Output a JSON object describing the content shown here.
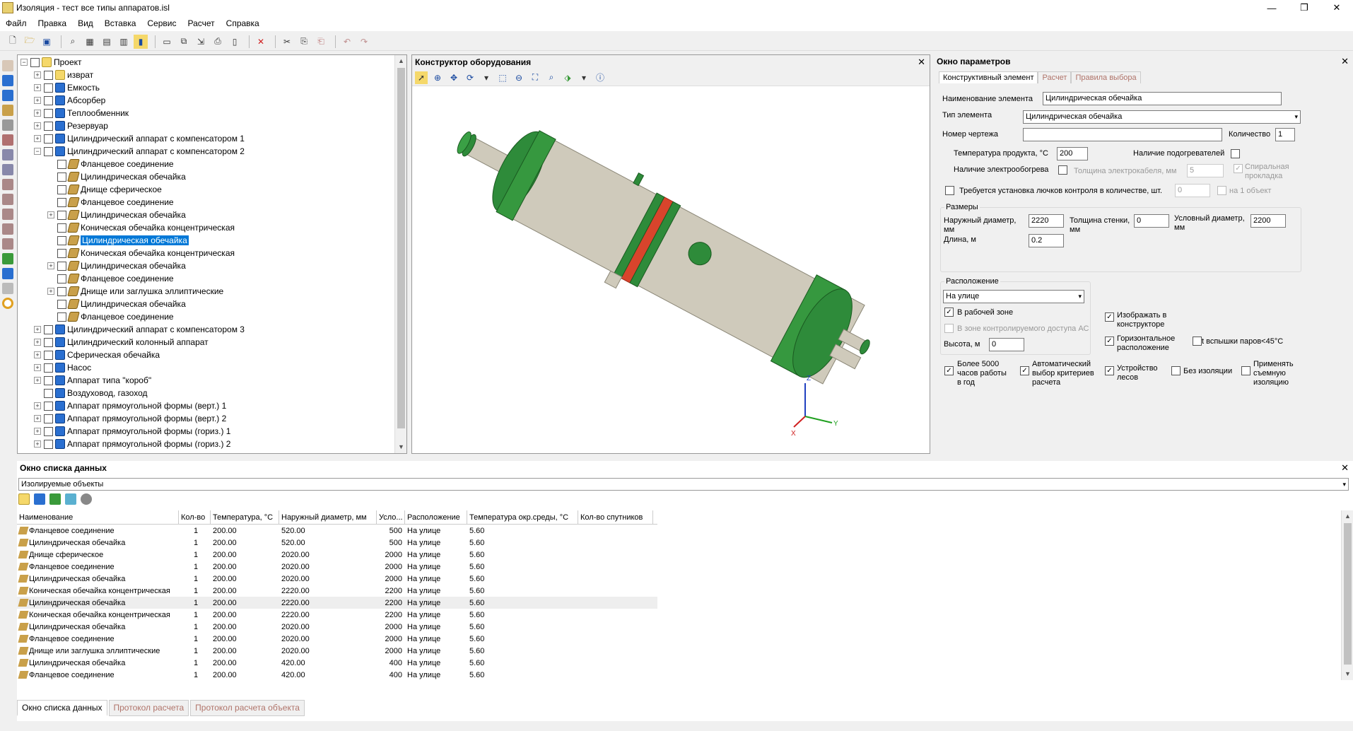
{
  "window": {
    "title": "Изоляция - тест все типы аппаратов.isl",
    "min": "—",
    "max": "❐",
    "close": "✕"
  },
  "menu": [
    "Файл",
    "Правка",
    "Вид",
    "Вставка",
    "Сервис",
    "Расчет",
    "Справка"
  ],
  "tree": {
    "items": [
      {
        "label": "Проект",
        "level": 0,
        "exp": "−",
        "icon": "folder-icon"
      },
      {
        "label": "изврат",
        "level": 1,
        "exp": "+",
        "icon": "folder-icon"
      },
      {
        "label": "Емкость",
        "level": 1,
        "exp": "+",
        "icon": "vessel-icon"
      },
      {
        "label": "Абсорбер",
        "level": 1,
        "exp": "+",
        "icon": "vessel-icon"
      },
      {
        "label": "Теплообменник",
        "level": 1,
        "exp": "+",
        "icon": "vessel-icon"
      },
      {
        "label": "Резервуар",
        "level": 1,
        "exp": "+",
        "icon": "vessel-icon"
      },
      {
        "label": "Цилиндрический аппарат с компенсатором 1",
        "level": 1,
        "exp": "+",
        "icon": "vessel-icon"
      },
      {
        "label": "Цилиндрический аппарат с компенсатором 2",
        "level": 1,
        "exp": "−",
        "icon": "vessel-icon"
      },
      {
        "label": "Фланцевое соединение",
        "level": 2,
        "exp": "",
        "icon": "part-icon"
      },
      {
        "label": "Цилиндрическая обечайка",
        "level": 2,
        "exp": "",
        "icon": "part-icon"
      },
      {
        "label": "Днище сферическое",
        "level": 2,
        "exp": "",
        "icon": "part-icon"
      },
      {
        "label": "Фланцевое соединение",
        "level": 2,
        "exp": "",
        "icon": "part-icon"
      },
      {
        "label": "Цилиндрическая обечайка",
        "level": 2,
        "exp": "+",
        "icon": "part-icon"
      },
      {
        "label": "Коническая обечайка концентрическая",
        "level": 2,
        "exp": "",
        "icon": "part-icon"
      },
      {
        "label": "Цилиндрическая обечайка",
        "level": 2,
        "exp": "",
        "icon": "part-icon",
        "selected": true
      },
      {
        "label": "Коническая обечайка концентрическая",
        "level": 2,
        "exp": "",
        "icon": "part-icon"
      },
      {
        "label": "Цилиндрическая обечайка",
        "level": 2,
        "exp": "+",
        "icon": "part-icon"
      },
      {
        "label": "Фланцевое соединение",
        "level": 2,
        "exp": "",
        "icon": "part-icon"
      },
      {
        "label": "Днище или заглушка эллиптические",
        "level": 2,
        "exp": "+",
        "icon": "part-icon"
      },
      {
        "label": "Цилиндрическая обечайка",
        "level": 2,
        "exp": "",
        "icon": "part-icon"
      },
      {
        "label": "Фланцевое соединение",
        "level": 2,
        "exp": "",
        "icon": "part-icon"
      },
      {
        "label": "Цилиндрический аппарат с компенсатором 3",
        "level": 1,
        "exp": "+",
        "icon": "vessel-icon"
      },
      {
        "label": "Цилиндрический колонный аппарат",
        "level": 1,
        "exp": "+",
        "icon": "vessel-icon"
      },
      {
        "label": "Сферическая обечайка",
        "level": 1,
        "exp": "+",
        "icon": "vessel-icon"
      },
      {
        "label": "Насос",
        "level": 1,
        "exp": "+",
        "icon": "vessel-icon"
      },
      {
        "label": "Аппарат типа \"короб\"",
        "level": 1,
        "exp": "+",
        "icon": "vessel-icon"
      },
      {
        "label": "Воздуховод, газоход",
        "level": 1,
        "exp": "",
        "icon": "vessel-icon"
      },
      {
        "label": "Аппарат прямоугольной формы (верт.) 1",
        "level": 1,
        "exp": "+",
        "icon": "vessel-icon"
      },
      {
        "label": "Аппарат прямоугольной формы (верт.) 2",
        "level": 1,
        "exp": "+",
        "icon": "vessel-icon"
      },
      {
        "label": "Аппарат прямоугольной формы (гориз.) 1",
        "level": 1,
        "exp": "+",
        "icon": "vessel-icon"
      },
      {
        "label": "Аппарат прямоугольной формы (гориз.) 2",
        "level": 1,
        "exp": "+",
        "icon": "vessel-icon"
      }
    ]
  },
  "designer": {
    "title": "Конструктор оборудования",
    "close": "✕",
    "axis_z": "Z",
    "axis_y": "Y",
    "axis_x": "X"
  },
  "params": {
    "title": "Окно параметров",
    "close": "✕",
    "tabs": [
      "Конструктивный элемент",
      "Расчет",
      "Правила выбора"
    ],
    "name_label": "Наименование элемента",
    "name_value": "Цилиндрическая обечайка",
    "type_label": "Тип элемента",
    "type_value": "Цилиндрическая обечайка",
    "drawing_label": "Номер чертежа",
    "drawing_value": "",
    "qty_label": "Количество",
    "qty_value": "1",
    "temp_label": "Температура продукта, °С",
    "temp_value": "200",
    "heaters_label": "Наличие подогревателей",
    "elheat_label": "Наличие электрообогрева",
    "cable_label": "Толщина электрокабеля, мм",
    "cable_value": "5",
    "spiral_label_1": "Спиральная",
    "spiral_label_2": "прокладка",
    "hatch_label": "Требуется установка лючков контроля в количестве, шт.",
    "hatch_value": "0",
    "per_object_label": "на 1 объект",
    "sizes_title": "Размеры",
    "outer_diam_label_1": "Наружный диаметр,",
    "outer_diam_label_2": "мм",
    "outer_diam_value": "2220",
    "wall_label_1": "Толщина стенки,",
    "wall_label_2": "мм",
    "wall_value": "0",
    "cond_diam_label_1": "Условный диаметр,",
    "cond_diam_label_2": "мм",
    "cond_diam_value": "2200",
    "length_label": "Длина, м",
    "length_value": "0.2",
    "location_title": "Расположение",
    "location_value": "На улице",
    "workzone_label": "В рабочей зоне",
    "controlzone_label": "В зоне контролируемого доступа АС",
    "height_label": "Высота, м",
    "height_value": "0",
    "show_label_1": "Изображать в",
    "show_label_2": "конструкторе",
    "horiz_label_1": "Горизонтальное",
    "horiz_label_2": "расположение",
    "flash_label": "t вспышки паров<45°С",
    "hours_label_1": "Более 5000",
    "hours_label_2": "часов работы",
    "hours_label_3": "в год",
    "auto_label_1": "Автоматический",
    "auto_label_2": "выбор критериев",
    "auto_label_3": "расчета",
    "scaffold_label_1": "Устройство",
    "scaffold_label_2": "лесов",
    "noins_label": "Без изоляции",
    "removable_label_1": "Применять",
    "removable_label_2": "съемную",
    "removable_label_3": "изоляцию"
  },
  "datalist": {
    "title": "Окно списка данных",
    "close": "✕",
    "selector": "Изолируемые объекты",
    "columns": [
      "Наименование",
      "Кол-во",
      "Температура, °С",
      "Наружный диаметр, мм",
      "Усло...",
      "Расположение",
      "Температура окр.среды, °С",
      "Кол-во спутников"
    ],
    "rows": [
      [
        "Фланцевое соединение",
        "1",
        "200.00",
        "520.00",
        "500",
        "На улице",
        "5.60",
        ""
      ],
      [
        "Цилиндрическая обечайка",
        "1",
        "200.00",
        "520.00",
        "500",
        "На улице",
        "5.60",
        ""
      ],
      [
        "Днище сферическое",
        "1",
        "200.00",
        "2020.00",
        "2000",
        "На улице",
        "5.60",
        ""
      ],
      [
        "Фланцевое соединение",
        "1",
        "200.00",
        "2020.00",
        "2000",
        "На улице",
        "5.60",
        ""
      ],
      [
        "Цилиндрическая обечайка",
        "1",
        "200.00",
        "2020.00",
        "2000",
        "На улице",
        "5.60",
        ""
      ],
      [
        "Коническая обечайка концентрическая",
        "1",
        "200.00",
        "2220.00",
        "2200",
        "На улице",
        "5.60",
        ""
      ],
      [
        "Цилиндрическая обечайка",
        "1",
        "200.00",
        "2220.00",
        "2200",
        "На улице",
        "5.60",
        ""
      ],
      [
        "Коническая обечайка концентрическая",
        "1",
        "200.00",
        "2220.00",
        "2200",
        "На улице",
        "5.60",
        ""
      ],
      [
        "Цилиндрическая обечайка",
        "1",
        "200.00",
        "2020.00",
        "2000",
        "На улице",
        "5.60",
        ""
      ],
      [
        "Фланцевое соединение",
        "1",
        "200.00",
        "2020.00",
        "2000",
        "На улице",
        "5.60",
        ""
      ],
      [
        "Днище или заглушка эллиптические",
        "1",
        "200.00",
        "2020.00",
        "2000",
        "На улице",
        "5.60",
        ""
      ],
      [
        "Цилиндрическая обечайка",
        "1",
        "200.00",
        "420.00",
        "400",
        "На улице",
        "5.60",
        ""
      ],
      [
        "Фланцевое соединение",
        "1",
        "200.00",
        "420.00",
        "400",
        "На улице",
        "5.60",
        ""
      ]
    ],
    "selected_row": 6
  },
  "bottom_tabs": [
    "Окно списка данных",
    "Протокол расчета",
    "Протокол расчета объекта"
  ],
  "colors": {
    "accent": "#0078d7",
    "vessel_green": "#2e8b3a",
    "vessel_body": "#cfcabb",
    "ring_red": "#d8442c"
  }
}
